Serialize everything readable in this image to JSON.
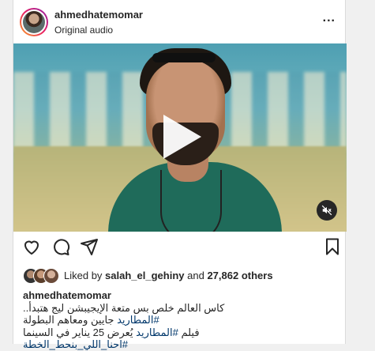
{
  "post": {
    "username": "ahmedhatemomar",
    "subtitle": "Original audio",
    "more_label": "..."
  },
  "video": {
    "state": "paused",
    "sound": "muted"
  },
  "actions": {
    "like_icon": "heart-icon",
    "comment_icon": "comment-icon",
    "share_icon": "paper-plane-icon",
    "save_icon": "bookmark-icon"
  },
  "likes": {
    "prefix": "Liked by",
    "user": "salah_el_gehiny",
    "conjunction": "and",
    "count": "27,862 others"
  },
  "caption": {
    "username": "ahmedhatemomar",
    "line1": "كاس العالم خلص بس متعة الإيجيبشن ليج هتبدأ..",
    "line2_tag": "#المطاريد",
    "line2_text": " جايين ومعاهم البطولة",
    "line3_prefix": "فيلم ",
    "line3_tag": "#المطاريد",
    "line3_text": " يُعرض 25 يناير في السينما",
    "line4_tag": "#احنا_اللي_بنحط_الخطة"
  },
  "colors": {
    "hashtag": "#00376b",
    "text": "#262626",
    "background": "#f0f0f0"
  }
}
